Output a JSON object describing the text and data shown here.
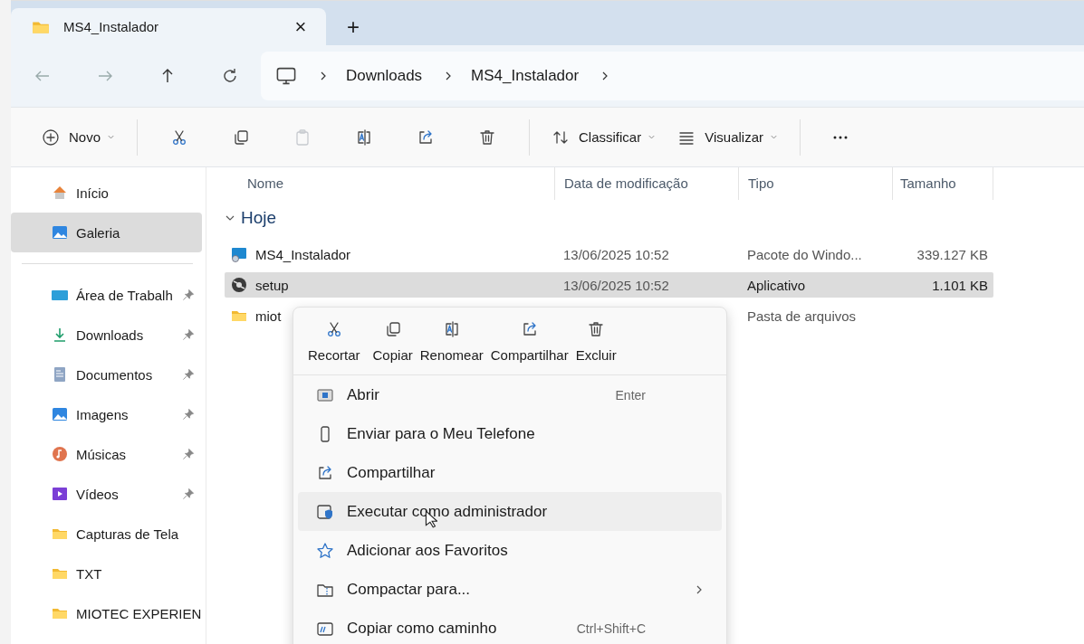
{
  "tab": {
    "title": "MS4_Instalador",
    "close": "×",
    "new_tab": "+"
  },
  "address": {
    "crumbs": [
      "Downloads",
      "MS4_Instalador"
    ]
  },
  "toolbar": [
    {
      "kind": "dropdown",
      "label": "Novo",
      "disabled": false
    },
    {
      "kind": "separator"
    },
    {
      "kind": "icon",
      "disabled": false
    },
    {
      "kind": "icon",
      "disabled": false
    },
    {
      "kind": "icon",
      "disabled": true
    },
    {
      "kind": "icon",
      "disabled": false
    },
    {
      "kind": "icon",
      "disabled": false
    },
    {
      "kind": "icon",
      "disabled": false
    },
    {
      "kind": "separator"
    },
    {
      "kind": "dropdown",
      "label": "Classificar",
      "disabled": false
    },
    {
      "kind": "dropdown",
      "label": "Visualizar",
      "disabled": false
    },
    {
      "kind": "separator"
    },
    {
      "kind": "icon",
      "disabled": false
    }
  ],
  "sidebar": {
    "top": [
      {
        "label": "Início",
        "kind": "home",
        "selected": false
      },
      {
        "label": "Galeria",
        "kind": "gallery",
        "selected": true
      }
    ],
    "items": [
      {
        "label": "Área de Trabalh",
        "kind": "desktop",
        "pinned": true
      },
      {
        "label": "Downloads",
        "kind": "download",
        "pinned": true
      },
      {
        "label": "Documentos",
        "kind": "document",
        "pinned": true
      },
      {
        "label": "Imagens",
        "kind": "pictures",
        "pinned": true
      },
      {
        "label": "Músicas",
        "kind": "music",
        "pinned": true
      },
      {
        "label": "Vídeos",
        "kind": "video",
        "pinned": true
      },
      {
        "label": "Capturas de Tela",
        "kind": "folder",
        "pinned": false
      },
      {
        "label": "TXT",
        "kind": "folder",
        "pinned": false
      },
      {
        "label": "MIOTEC EXPERIEN",
        "kind": "folder"
      }
    ]
  },
  "table": {
    "columns": [
      "Nome",
      "Data de modificação",
      "Tipo",
      "Tamanho"
    ],
    "group": {
      "label": "Hoje",
      "expanded": true
    },
    "rows": [
      {
        "name": "MS4_Instalador",
        "kind": "installer",
        "date": "13/06/2025 10:52",
        "type": "Pacote do Windo...",
        "size": "339.127 KB",
        "selected": false
      },
      {
        "name": "setup",
        "kind": "app",
        "date": "13/06/2025 10:52",
        "type": "Aplicativo",
        "size": "1.101 KB",
        "selected": true
      },
      {
        "name": "miot",
        "kind": "folder",
        "type": "Pasta de arquivos",
        "selected": false
      }
    ]
  },
  "context_menu": {
    "actions": [
      {
        "label": "Recortar"
      },
      {
        "label": "Copiar"
      },
      {
        "label": "Renomear"
      },
      {
        "label": "Compartilhar"
      },
      {
        "label": "Excluir"
      }
    ],
    "items": [
      {
        "label": "Abrir",
        "shortcut": "Enter",
        "submenu": false,
        "hovered": false
      },
      {
        "label": "Enviar para o Meu Telefone",
        "submenu": false,
        "hovered": false
      },
      {
        "label": "Compartilhar",
        "submenu": false,
        "hovered": false
      },
      {
        "label": "Executar como administrador",
        "submenu": false,
        "hovered": true
      },
      {
        "label": "Adicionar aos Favoritos",
        "submenu": false,
        "hovered": false
      },
      {
        "label": "Compactar para...",
        "submenu": true,
        "hovered": false
      },
      {
        "label": "Copiar como caminho",
        "shortcut": "Ctrl+Shift+C",
        "submenu": false,
        "hovered": false
      }
    ]
  }
}
